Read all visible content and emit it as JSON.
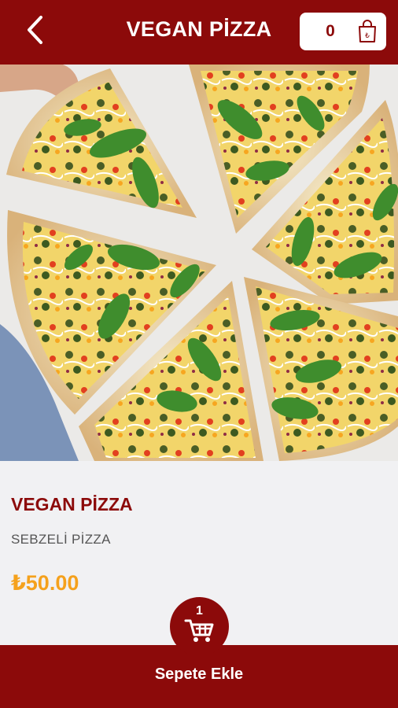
{
  "header": {
    "title": "VEGAN PİZZA",
    "cart_count": "0"
  },
  "product": {
    "name": "VEGAN PİZZA",
    "description": "SEBZELİ PİZZA",
    "price": "₺50.00",
    "quantity": "1"
  },
  "actions": {
    "add_to_cart_label": "Sepete Ekle"
  },
  "icons": {
    "back": "chevron-left-icon",
    "bag": "shopping-bag-lira-icon",
    "cart": "shopping-cart-icon"
  },
  "colors": {
    "primary": "#8c0a0a",
    "price": "#f5a11c",
    "background": "#f1f1f3",
    "description": "#555555"
  }
}
